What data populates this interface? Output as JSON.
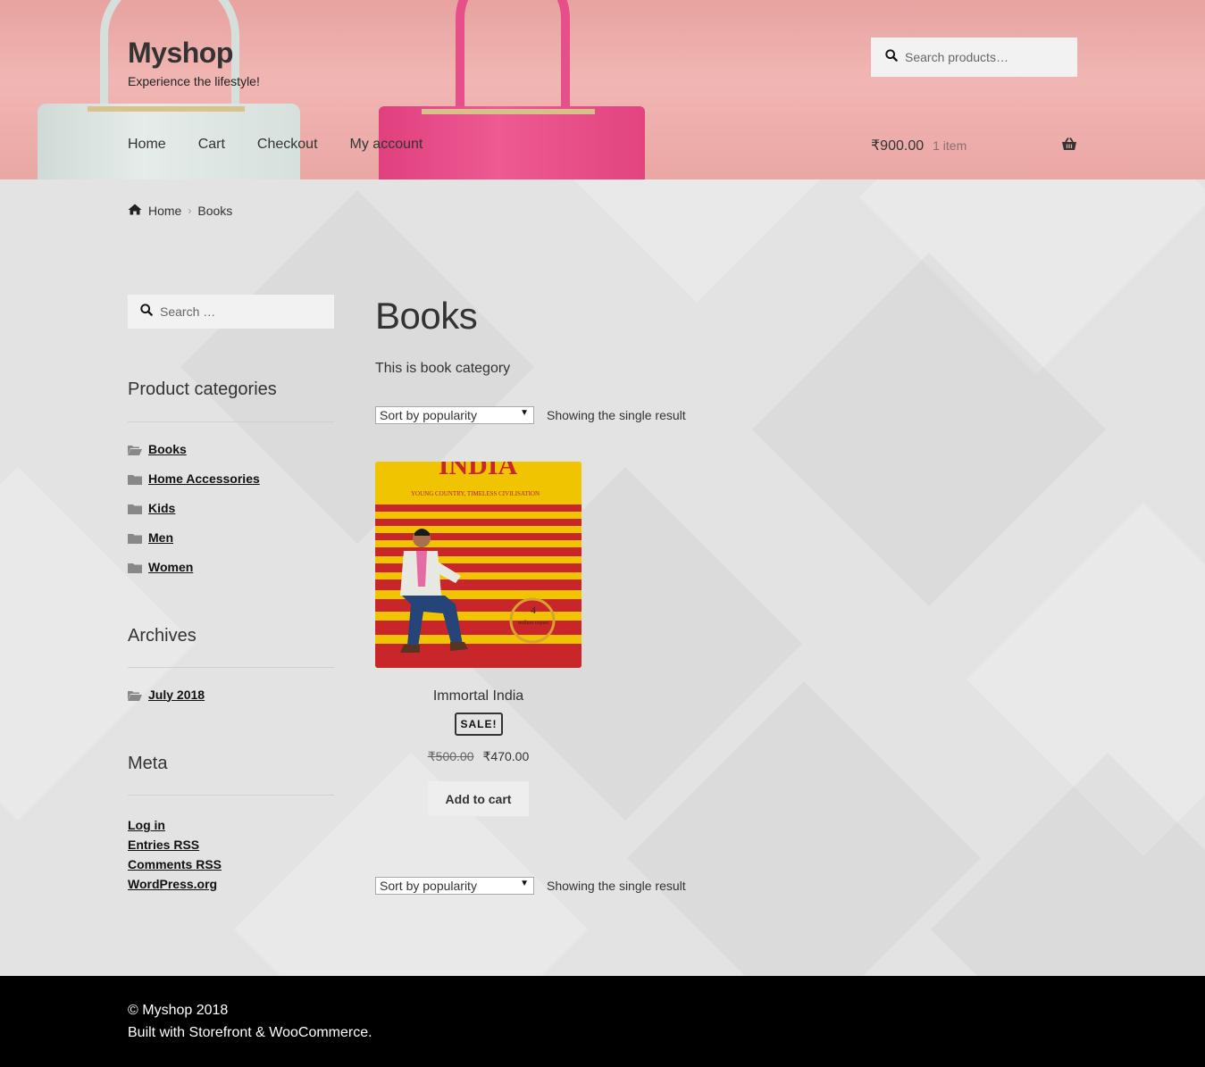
{
  "header": {
    "site_title": "Myshop",
    "tagline": "Experience the lifestyle!",
    "search_placeholder": "Search products…",
    "nav": [
      "Home",
      "Cart",
      "Checkout",
      "My account"
    ],
    "cart_amount": "₹900.00",
    "cart_count": "1 item"
  },
  "breadcrumb": {
    "home": "Home",
    "current": "Books"
  },
  "sidebar": {
    "search_placeholder": "Search …",
    "categories_title": "Product categories",
    "categories": [
      "Books",
      "Home Accessories",
      "Kids",
      "Men",
      "Women"
    ],
    "archives_title": "Archives",
    "archives": [
      "July 2018"
    ],
    "meta_title": "Meta",
    "meta_links": [
      "Log in",
      "Entries RSS",
      "Comments RSS",
      "WordPress.org"
    ]
  },
  "main": {
    "title": "Books",
    "description": "This is book category",
    "sort_label": "Sort by popularity",
    "result_count": "Showing the single result",
    "product": {
      "name": "Immortal India",
      "badge": "SALE!",
      "old_price": "₹500.00",
      "price": "₹470.00",
      "button": "Add to cart",
      "cover_title": "INDIA",
      "cover_subtitle": "YOUNG COUNTRY, TIMELESS CIVILISATION",
      "seal_number": "4",
      "seal_text": "million copies"
    }
  },
  "footer": {
    "copyright": "© Myshop 2018",
    "built_with": "Built with Storefront & WooCommerce."
  },
  "colors": {
    "header_pink": "#e7a3a0",
    "footer_bg": "#000000",
    "content_bg": "#e3e3e3"
  }
}
